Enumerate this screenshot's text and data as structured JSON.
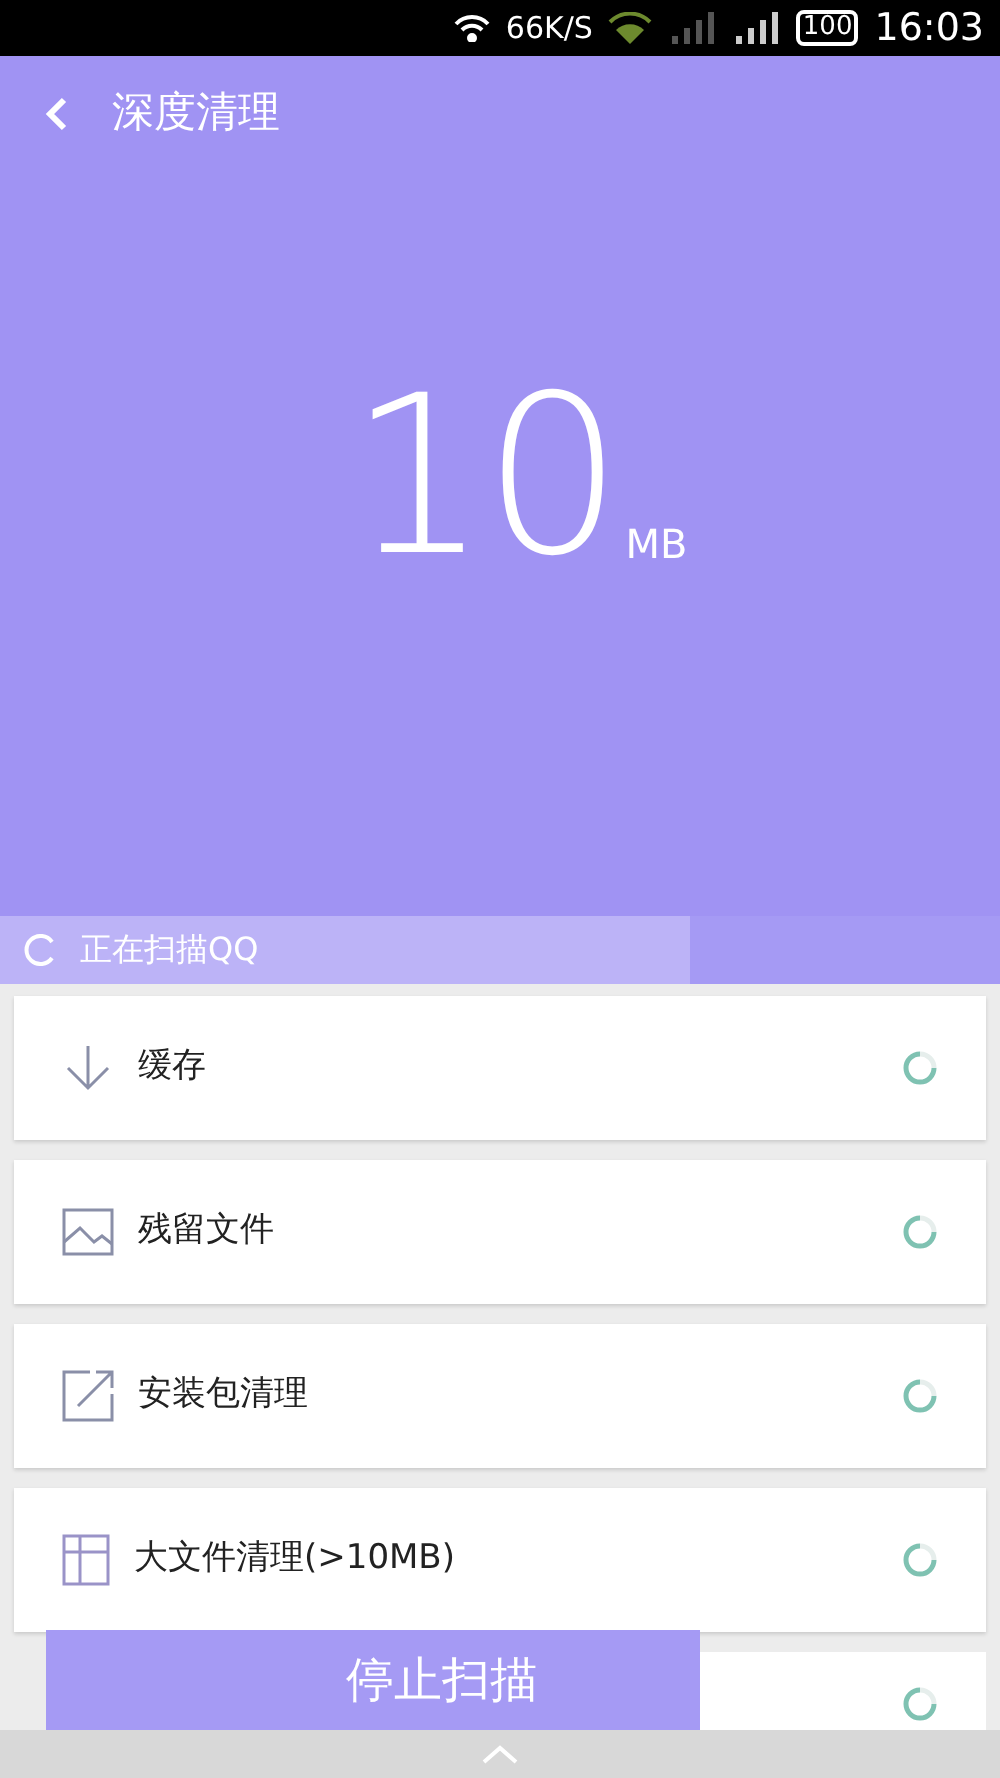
{
  "status_bar": {
    "speed": "66K/S",
    "battery": "100",
    "time": "16:03"
  },
  "header": {
    "title": "深度清理",
    "amount": "10",
    "unit": "MB"
  },
  "scan": {
    "text": "正在扫描QQ",
    "level": 0.69
  },
  "items": [
    {
      "label": "缓存",
      "kind": "download"
    },
    {
      "label": "残留文件",
      "kind": "image"
    },
    {
      "label": "安装包清理",
      "kind": "export"
    },
    {
      "label": "大文件清理(>10MB)",
      "kind": "grid"
    }
  ],
  "stop_button": "停止扫描"
}
